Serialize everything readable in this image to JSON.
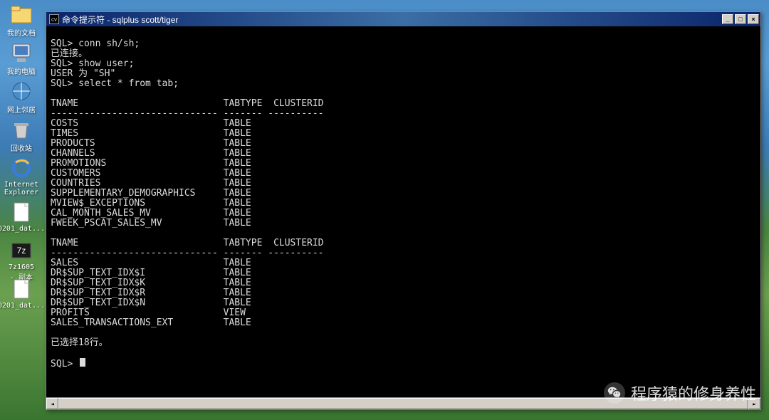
{
  "desktop_icons": [
    {
      "label": "我的文档"
    },
    {
      "label": "我的电脑"
    },
    {
      "label": "网上邻居"
    },
    {
      "label": "回收站"
    },
    {
      "label": "Internet Explorer"
    },
    {
      "label": "0201_dat..."
    },
    {
      "label": "7z1605 - 副本"
    },
    {
      "label": "0201_dat..."
    }
  ],
  "window": {
    "title": "命令提示符 - sqlplus scott/tiger",
    "icon_label": "cv"
  },
  "buttons": {
    "min": "_",
    "max": "□",
    "close": "×"
  },
  "scroll": {
    "left": "◄",
    "right": "►"
  },
  "terminal": {
    "lines": [
      "",
      "SQL> conn sh/sh;",
      "已连接。",
      "SQL> show user;",
      "USER 为 \"SH\"",
      "SQL> select * from tab;",
      "",
      "TNAME                          TABTYPE  CLUSTERID",
      "------------------------------ ------- ----------",
      "COSTS                          TABLE",
      "TIMES                          TABLE",
      "PRODUCTS                       TABLE",
      "CHANNELS                       TABLE",
      "PROMOTIONS                     TABLE",
      "CUSTOMERS                      TABLE",
      "COUNTRIES                      TABLE",
      "SUPPLEMENTARY_DEMOGRAPHICS     TABLE",
      "MVIEW$_EXCEPTIONS              TABLE",
      "CAL_MONTH_SALES_MV             TABLE",
      "FWEEK_PSCAT_SALES_MV           TABLE",
      "",
      "TNAME                          TABTYPE  CLUSTERID",
      "------------------------------ ------- ----------",
      "SALES                          TABLE",
      "DR$SUP_TEXT_IDX$I              TABLE",
      "DR$SUP_TEXT_IDX$K              TABLE",
      "DR$SUP_TEXT_IDX$R              TABLE",
      "DR$SUP_TEXT_IDX$N              TABLE",
      "PROFITS                        VIEW",
      "SALES_TRANSACTIONS_EXT         TABLE",
      "",
      "已选择18行。",
      ""
    ],
    "prompt": "SQL> "
  },
  "watermark": "程序猿的修身养性"
}
